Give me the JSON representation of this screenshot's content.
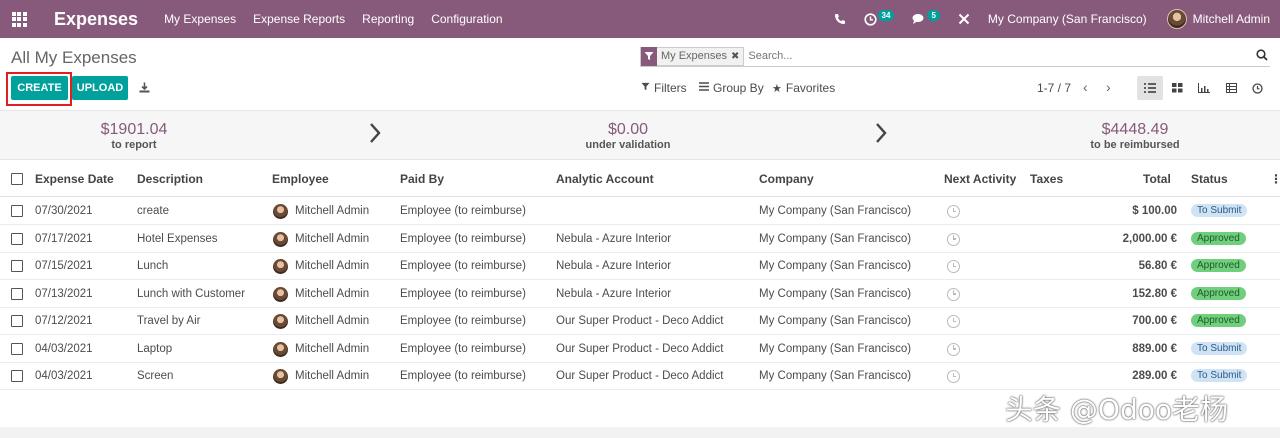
{
  "navbar": {
    "brand": "Expenses",
    "menu": [
      "My Expenses",
      "Expense Reports",
      "Reporting",
      "Configuration"
    ],
    "activity_badge": "34",
    "message_badge": "5",
    "company": "My Company (San Francisco)",
    "user": "Mitchell Admin"
  },
  "control": {
    "breadcrumb": "All My Expenses",
    "facet_label": "My Expenses",
    "search_placeholder": "Search...",
    "create_label": "CREATE",
    "upload_label": "UPLOAD",
    "filters_label": "Filters",
    "groupby_label": "Group By",
    "favorites_label": "Favorites",
    "pager": "1-7 / 7"
  },
  "summary": [
    {
      "amount": "$1901.04",
      "label": "to report"
    },
    {
      "amount": "$0.00",
      "label": "under validation"
    },
    {
      "amount": "$4448.49",
      "label": "to be reimbursed"
    }
  ],
  "table": {
    "headers": {
      "date": "Expense Date",
      "description": "Description",
      "employee": "Employee",
      "paid_by": "Paid By",
      "analytic": "Analytic Account",
      "company": "Company",
      "activity": "Next Activity",
      "taxes": "Taxes",
      "total": "Total",
      "status": "Status"
    },
    "rows": [
      {
        "date": "07/30/2021",
        "description": "create",
        "employee": "Mitchell Admin",
        "paid_by": "Employee (to reimburse)",
        "analytic": "",
        "company": "My Company (San Francisco)",
        "total": "$ 100.00",
        "status": "To Submit"
      },
      {
        "date": "07/17/2021",
        "description": "Hotel Expenses",
        "employee": "Mitchell Admin",
        "paid_by": "Employee (to reimburse)",
        "analytic": "Nebula - Azure Interior",
        "company": "My Company (San Francisco)",
        "total": "2,000.00 €",
        "status": "Approved"
      },
      {
        "date": "07/15/2021",
        "description": "Lunch",
        "employee": "Mitchell Admin",
        "paid_by": "Employee (to reimburse)",
        "analytic": "Nebula - Azure Interior",
        "company": "My Company (San Francisco)",
        "total": "56.80 €",
        "status": "Approved"
      },
      {
        "date": "07/13/2021",
        "description": "Lunch with Customer",
        "employee": "Mitchell Admin",
        "paid_by": "Employee (to reimburse)",
        "analytic": "Nebula - Azure Interior",
        "company": "My Company (San Francisco)",
        "total": "152.80 €",
        "status": "Approved"
      },
      {
        "date": "07/12/2021",
        "description": "Travel by Air",
        "employee": "Mitchell Admin",
        "paid_by": "Employee (to reimburse)",
        "analytic": "Our Super Product - Deco Addict",
        "company": "My Company (San Francisco)",
        "total": "700.00 €",
        "status": "Approved"
      },
      {
        "date": "04/03/2021",
        "description": "Laptop",
        "employee": "Mitchell Admin",
        "paid_by": "Employee (to reimburse)",
        "analytic": "Our Super Product - Deco Addict",
        "company": "My Company (San Francisco)",
        "total": "889.00 €",
        "status": "To Submit"
      },
      {
        "date": "04/03/2021",
        "description": "Screen",
        "employee": "Mitchell Admin",
        "paid_by": "Employee (to reimburse)",
        "analytic": "Our Super Product - Deco Addict",
        "company": "My Company (San Francisco)",
        "total": "289.00 €",
        "status": "To Submit"
      }
    ]
  },
  "watermark": "头条 @Odoo老杨",
  "colors": {
    "brand": "#875a7b",
    "accent": "#00a09d",
    "approved": "#6fcf7d",
    "to_submit": "#cfe3f5"
  },
  "icons": [
    "apps-grid-icon",
    "phone-icon",
    "activity-clock-icon",
    "chat-icon",
    "tools-icon",
    "filter-icon",
    "search-icon",
    "download-icon",
    "list-view-icon",
    "kanban-view-icon",
    "graph-view-icon",
    "pivot-view-icon",
    "activity-view-icon"
  ]
}
